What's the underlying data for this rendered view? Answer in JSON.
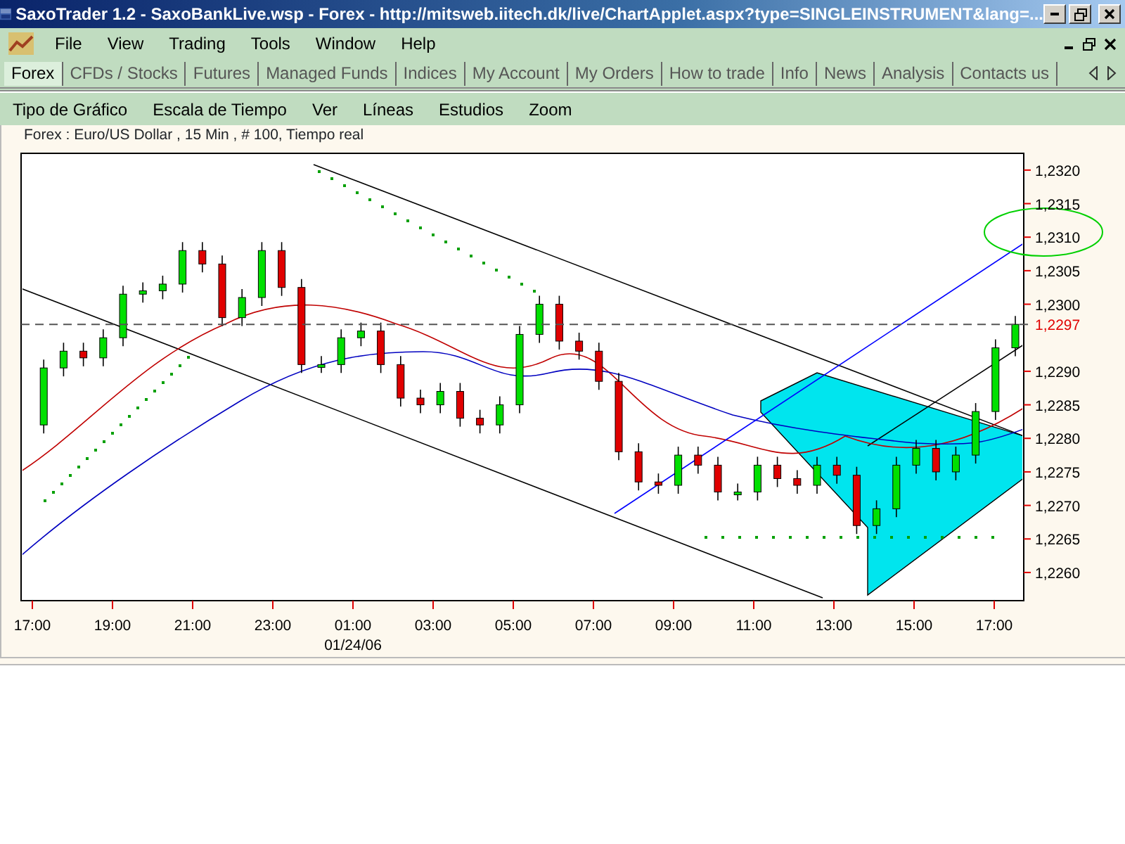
{
  "window": {
    "title": "SaxoTrader 1.2 - SaxoBankLive.wsp - Forex - http://mitsweb.iitech.dk/live/ChartApplet.aspx?type=SINGLEINSTRUMENT&lang=..."
  },
  "menu": [
    "File",
    "View",
    "Trading",
    "Tools",
    "Window",
    "Help"
  ],
  "tabs": [
    {
      "label": "Forex",
      "selected": true
    },
    {
      "label": "CFDs / Stocks",
      "selected": false
    },
    {
      "label": "Futures",
      "selected": false
    },
    {
      "label": "Managed Funds",
      "selected": false
    },
    {
      "label": "Indices",
      "selected": false
    },
    {
      "label": "My Account",
      "selected": false
    },
    {
      "label": "My Orders",
      "selected": false
    },
    {
      "label": "How to trade",
      "selected": false
    },
    {
      "label": "Info",
      "selected": false
    },
    {
      "label": "News",
      "selected": false
    },
    {
      "label": "Analysis",
      "selected": false
    },
    {
      "label": "Contacts us",
      "selected": false
    }
  ],
  "chart_menu": [
    "Tipo de Gráfico",
    "Escala de Tiempo",
    "Ver",
    "Líneas",
    "Estudios",
    "Zoom"
  ],
  "chart": {
    "caption": "Forex : Euro/US Dollar , 15 Min , # 100, Tiempo real",
    "y_axis_labels": [
      "1,2320",
      "1,2315",
      "1,2310",
      "1,2305",
      "1,2300",
      "1,2290",
      "1,2285",
      "1,2280",
      "1,2275",
      "1,2270",
      "1,2265",
      "1,2260"
    ],
    "current_price": "1,2297",
    "x_axis_labels": [
      "17:00",
      "19:00",
      "21:00",
      "23:00",
      "01:00",
      "03:00",
      "05:00",
      "07:00",
      "09:00",
      "11:00",
      "13:00",
      "15:00",
      "17:00"
    ],
    "date_label": "01/24/06"
  }
}
